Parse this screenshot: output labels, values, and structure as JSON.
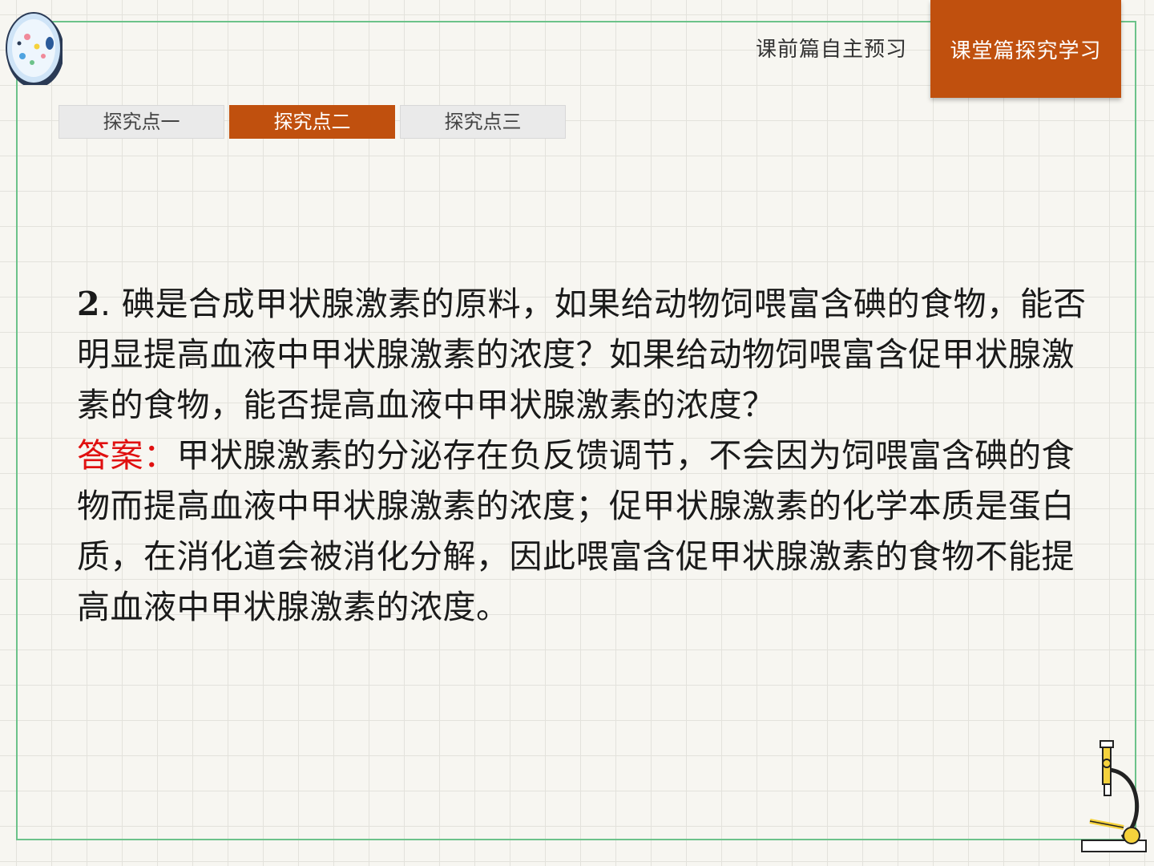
{
  "header": {
    "nav_preview": "课前篇自主预习",
    "nav_class": "课堂篇探究学习"
  },
  "tabs": [
    {
      "label": "探究点一",
      "active": false
    },
    {
      "label": "探究点二",
      "active": true
    },
    {
      "label": "探究点三",
      "active": false
    }
  ],
  "question": {
    "number": "2",
    "text": ". 碘是合成甲状腺激素的原料，如果给动物饲喂富含碘的食物，能否明显提高血液中甲状腺激素的浓度？如果给动物饲喂富含促甲状腺激素的食物，能否提高血液中甲状腺激素的浓度？"
  },
  "answer": {
    "label": "答案：",
    "text": "甲状腺激素的分泌存在负反馈调节，不会因为饲喂富含碘的食物而提高血液中甲状腺激素的浓度；促甲状腺激素的化学本质是蛋白质，在消化道会被消化分解，因此喂富含促甲状腺激素的食物不能提高血液中甲状腺激素的浓度。"
  },
  "colors": {
    "accent": "#c0500e",
    "answer_label": "#e01010",
    "frame": "#6cc28a"
  },
  "icons": [
    "bacteria-dish-icon",
    "microscope-icon"
  ]
}
